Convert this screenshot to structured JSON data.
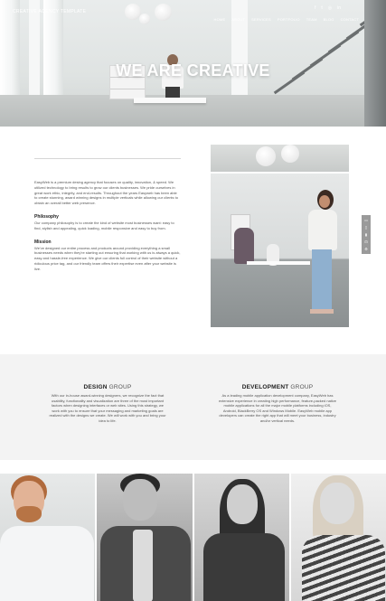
{
  "header": {
    "brand": "CREATIVE AGENCY TEMPLATE",
    "nav": [
      "HOME",
      "ABOUT",
      "SERVICES",
      "PORTFOLIO",
      "TEAM",
      "BLOG",
      "CONTACT"
    ],
    "social_icons": [
      "facebook-icon",
      "twitter-icon",
      "instagram-icon",
      "linkedin-icon"
    ],
    "hero_title": "WE ARE CREATIVE"
  },
  "about": {
    "intro": "EasyWeb is a premium desing agency that focuses on quality, innovation, & speed. We utilized technology to bring results to grow our clients businesses. We pride ourselves in great work ethic, integrity, and end-results. Throughout the years Easyweb has been able to create stunning, award winning designs in multiple verticals while allowing our clients to obtain an overall better web presence.",
    "philosophy_title": "Philosophy",
    "philosophy_text": "Our company philosophy is to create the kind of website most businesses want: easy to find, stylish and appealing, quick loading, mobile responsive and easy to buy from.",
    "mission_title": "Mission",
    "mission_text": "We've designed our entire process and products around providing everything a small businesses needs when they're starting out ensuring that working with us is always a quick, easy and hassle-free experience. We give our clients full control of their website without a ridiculous price tag, and our friendly team offers their expertise even after your website is live."
  },
  "side_tools": [
    "monitor-icon",
    "tablet-icon",
    "phone-icon",
    "cart-icon",
    "gear-icon"
  ],
  "groups": [
    {
      "title_bold": "DESIGN",
      "title_thin": "GROUP",
      "text": "With our in-house award-winning designers, we recognize the fact that usability, functionality and visualization are three of the most important factors when designing interfaces or web sites. Using this strategy, we work with you to ensure that your messaging and marketing goals are realized with the designs we create. We will work with you and bring your idea to life."
    },
    {
      "title_bold": "DEVELOPMENT",
      "title_thin": "GROUP",
      "text": "As a leading mobile application development company, EasyWeb has extensive experience in creating high performance, feature-packed native mobile applications for all the major mobile platforms including iOS, Android, BlackBerry OS and Windows Mobile. EasyWeb mobile app developers can create the right app that will meet your business, industry and/or vertical needs."
    }
  ],
  "team": [
    "team-member-1",
    "team-member-2",
    "team-member-3",
    "team-member-4"
  ]
}
